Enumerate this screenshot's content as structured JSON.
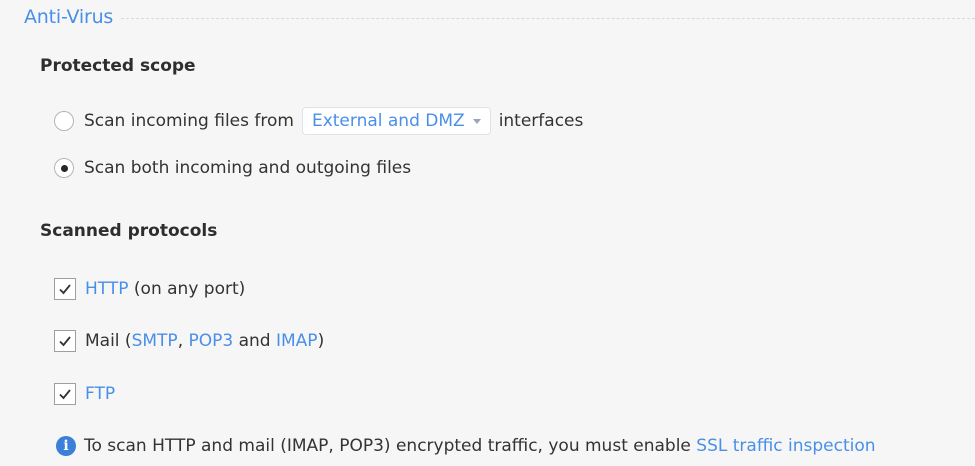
{
  "section": {
    "title": "Anti-Virus"
  },
  "protected_scope": {
    "heading": "Protected scope",
    "option_incoming": {
      "prefix": "Scan incoming files from",
      "dropdown_value": "External and DMZ",
      "suffix": "interfaces",
      "selected": false
    },
    "option_both": {
      "label": "Scan both incoming and outgoing files",
      "selected": true
    }
  },
  "scanned_protocols": {
    "heading": "Scanned protocols",
    "http": {
      "link": "HTTP",
      "suffix": "(on any port)",
      "checked": true
    },
    "mail": {
      "prefix": "Mail (",
      "smtp": "SMTP",
      "comma": ", ",
      "pop3": "POP3",
      "and": " and ",
      "imap": "IMAP",
      "close": ")",
      "checked": true
    },
    "ftp": {
      "link": "FTP",
      "checked": true
    }
  },
  "info": {
    "icon": "i",
    "text": "To scan HTTP and mail (IMAP, POP3) encrypted traffic, you must enable",
    "link": "SSL traffic inspection"
  },
  "colors": {
    "accent": "#4a8fe7",
    "background": "#f6f6f6",
    "info_icon": "#3b7fd8"
  }
}
